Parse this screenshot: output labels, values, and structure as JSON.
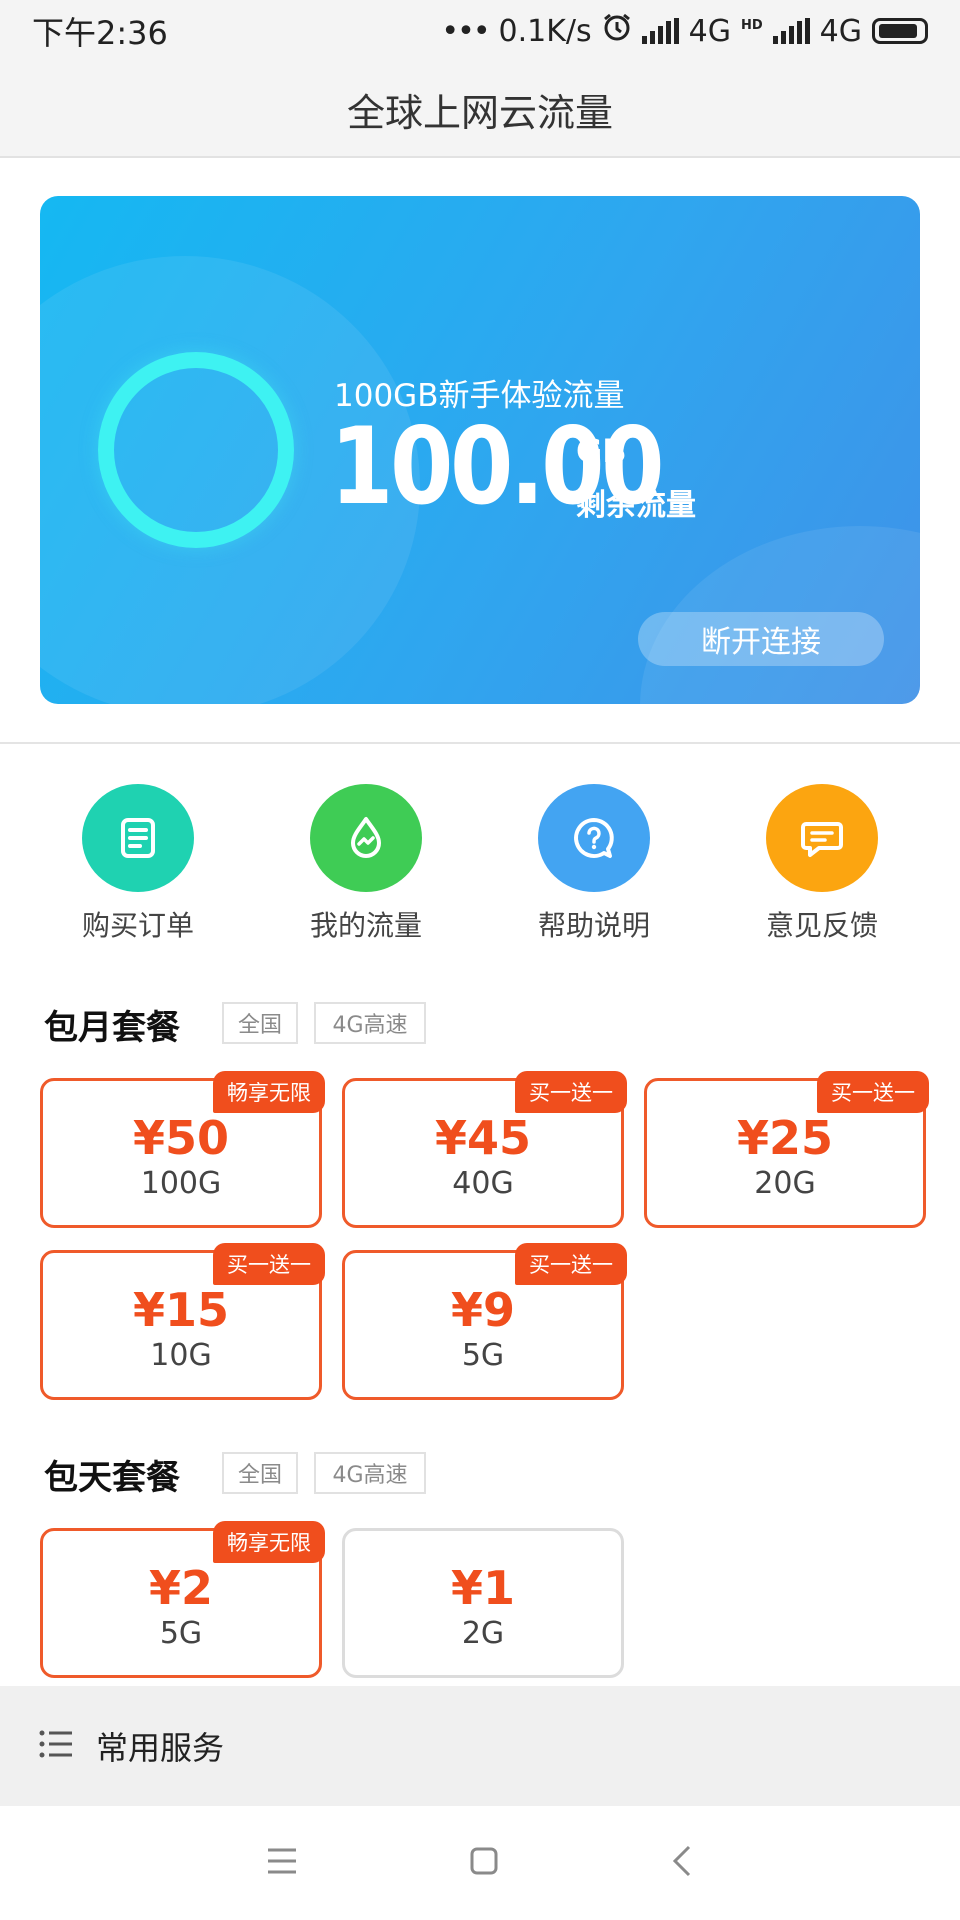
{
  "status_bar": {
    "time": "下午2:36",
    "speed": "0.1K/s",
    "net1": "4G",
    "hd": "HD",
    "net2": "4G"
  },
  "header": {
    "title": "全球上网云流量"
  },
  "hero": {
    "label": "100GB新手体验流量",
    "amount": "100.00",
    "unit": "GB",
    "sub": "剩余流量",
    "button": "断开连接"
  },
  "actions": [
    {
      "label": "购买订单",
      "icon": "document-icon",
      "color": "#1fd2b1"
    },
    {
      "label": "我的流量",
      "icon": "water-drop-icon",
      "color": "#3fcc55"
    },
    {
      "label": "帮助说明",
      "icon": "help-question-icon",
      "color": "#43a4f2"
    },
    {
      "label": "意见反馈",
      "icon": "chat-feedback-icon",
      "color": "#fca510"
    }
  ],
  "monthly": {
    "title": "包月套餐",
    "tags": [
      "全国",
      "4G高速"
    ],
    "plans": [
      {
        "price": "¥50",
        "size": "100G",
        "badge": "畅享无限"
      },
      {
        "price": "¥45",
        "size": "40G",
        "badge": "买一送一"
      },
      {
        "price": "¥25",
        "size": "20G",
        "badge": "买一送一"
      },
      {
        "price": "¥15",
        "size": "10G",
        "badge": "买一送一"
      },
      {
        "price": "¥9",
        "size": "5G",
        "badge": "买一送一"
      }
    ]
  },
  "daily": {
    "title": "包天套餐",
    "tags": [
      "全国",
      "4G高速"
    ],
    "plans": [
      {
        "price": "¥2",
        "size": "5G",
        "badge": "畅享无限"
      },
      {
        "price": "¥1",
        "size": "2G",
        "badge": ""
      }
    ]
  },
  "services": {
    "label": "常用服务"
  },
  "colors": {
    "accent": "#f04e1d",
    "hero_start": "#15b8f2",
    "hero_end": "#3f92e8",
    "ring": "#3ef2f2"
  }
}
